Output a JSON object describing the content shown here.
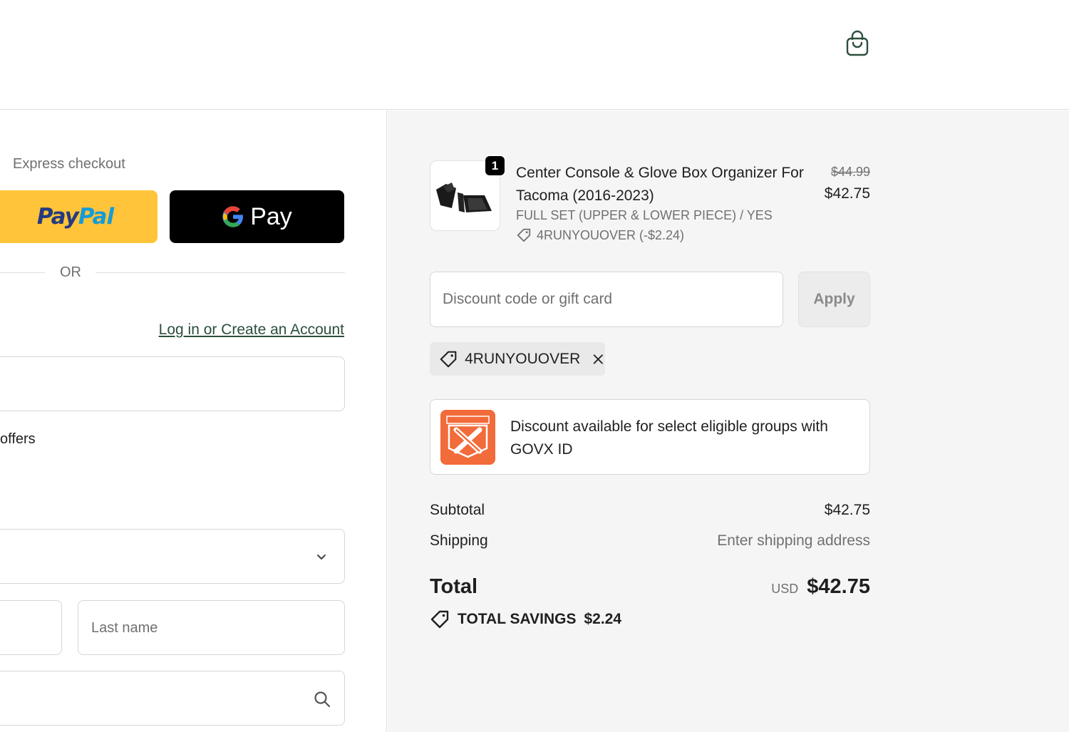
{
  "header": {
    "cart_icon": "shopping-bag-icon"
  },
  "express": {
    "label": "Express checkout",
    "paypal_pay": "Pay",
    "paypal_pal": "Pal",
    "gpay_label": "Pay",
    "or_label": "OR"
  },
  "account": {
    "login_link": "Log in or Create an Account"
  },
  "form": {
    "offers_text": "offers",
    "last_name_placeholder": "Last name"
  },
  "order": {
    "quantity": "1",
    "product_name": "Center Console & Glove Box Organizer For Tacoma (2016-2023)",
    "variant": "FULL SET (UPPER & LOWER PIECE) / YES",
    "applied_discount": "4RUNYOUOVER (-$2.24)",
    "price_original": "$44.99",
    "price_discounted": "$42.75"
  },
  "discount": {
    "placeholder": "Discount code or gift card",
    "apply_label": "Apply",
    "code_chip": "4RUNYOUOVER"
  },
  "govx": {
    "logo_text": "GOVX ID",
    "message": "Discount available for select eligible groups with GOVX ID"
  },
  "summary": {
    "subtotal_label": "Subtotal",
    "subtotal_value": "$42.75",
    "shipping_label": "Shipping",
    "shipping_value": "Enter shipping address",
    "total_label": "Total",
    "currency": "USD",
    "total_value": "$42.75",
    "savings_label": "TOTAL SAVINGS",
    "savings_value": "$2.24"
  },
  "colors": {
    "paypal_yellow": "#ffc439",
    "gpay_black": "#000000",
    "link_green": "#2b4f3b",
    "govx_orange": "#f26b3a",
    "summary_bg": "#f5f5f5"
  }
}
